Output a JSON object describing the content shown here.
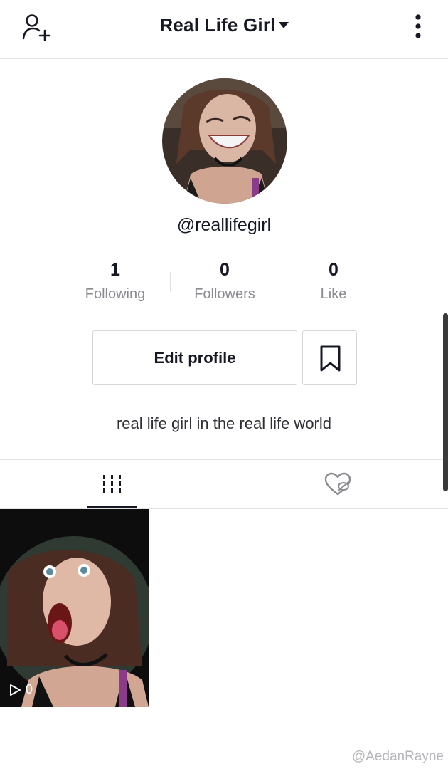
{
  "header": {
    "title": "Real Life Girl",
    "add_user_icon": "add-user-icon",
    "more_icon": "more-vertical-icon",
    "caret_icon": "caret-down-icon"
  },
  "profile": {
    "username": "@reallifegirl",
    "bio": "real life girl in the real life world",
    "stats": [
      {
        "value": "1",
        "label": "Following"
      },
      {
        "value": "0",
        "label": "Followers"
      },
      {
        "value": "0",
        "label": "Like"
      }
    ],
    "edit_label": "Edit profile",
    "bookmark_icon": "bookmark-icon"
  },
  "tabs": [
    {
      "icon": "grid-icon",
      "active": true
    },
    {
      "icon": "liked-hidden-icon",
      "active": false
    }
  ],
  "videos": [
    {
      "play_count": "0"
    }
  ],
  "watermark": "@AedanRayne",
  "colors": {
    "text": "#161823",
    "muted": "#8a8b91",
    "border": "#e3e3e4"
  }
}
